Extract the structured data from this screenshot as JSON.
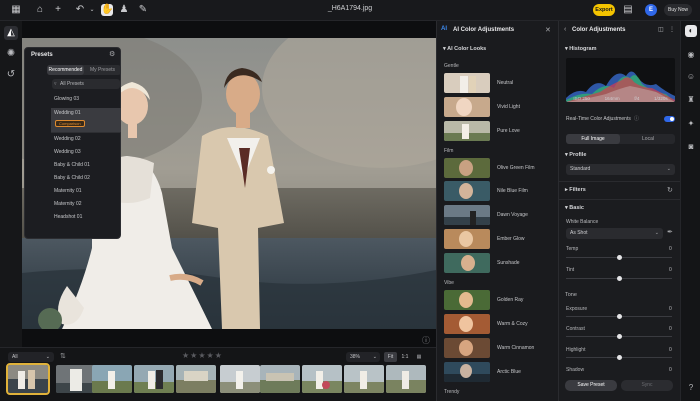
{
  "topbar": {
    "title": "_H6A1794.jpg",
    "export_label": "Export",
    "avatar_initial": "E",
    "buy_now_label": "Buy Now",
    "icons": [
      "grid-icon",
      "home-icon",
      "plus-icon",
      "undo-icon",
      "hand-icon",
      "stamp-icon",
      "brush-icon",
      "folder-icon",
      "gear-icon"
    ]
  },
  "presets": {
    "title": "Presets",
    "tabs": [
      "Recommended",
      "My Presets"
    ],
    "filter_label": "All Presets",
    "items": [
      "Glowing 03",
      "Wedding 01",
      "Wedding 02",
      "Wedding 03",
      "Baby & Child 01",
      "Baby & Child 02",
      "Maternity 01",
      "Maternity 02",
      "Headshot 01"
    ],
    "selected_item": "Wedding 01",
    "selected_tag": "Comparison"
  },
  "filmstrip": {
    "filter_value": "All",
    "zoom_value": "38%",
    "fit_label": "Fit",
    "one_to_one_label": "1:1",
    "stars": "★★★★★"
  },
  "ai_looks": {
    "title": "AI Color Adjustments",
    "section": "AI Color Looks",
    "groups": [
      {
        "name": "Gentle",
        "looks": [
          "Neutral",
          "Vivid Light",
          "Pure Love"
        ]
      },
      {
        "name": "Film",
        "looks": [
          "Olive Green Film",
          "Nile Blue Film",
          "Dawn Voyage",
          "Ember Glow",
          "Sunshade"
        ]
      },
      {
        "name": "Vibe",
        "looks": [
          "Golden Ray",
          "Warm & Cozy",
          "Warm Cinnamon",
          "Arctic Blue"
        ]
      },
      {
        "name": "Trendy",
        "looks": []
      }
    ]
  },
  "color_panel": {
    "title": "Color Adjustments",
    "histogram_label": "Histogram",
    "hist_info": [
      "ISO 250",
      "164mm",
      "f/4",
      "1/320s"
    ],
    "realtime_label": "Real-Time Color Adjustments",
    "realtime_on": true,
    "seg": [
      "Full Image",
      "Local"
    ],
    "profile_label": "Profile",
    "profile_value": "Standard",
    "filters_label": "Filters",
    "basic_label": "Basic",
    "white_balance_label": "White Balance",
    "white_balance_value": "As Shot",
    "temp_label": "Temp",
    "temp_value": "0",
    "tint_label": "Tint",
    "tint_value": "0",
    "tone_label": "Tone",
    "exposure_label": "Exposure",
    "exposure_value": "0",
    "contrast_label": "Contrast",
    "contrast_value": "0",
    "highlight_label": "Highlight",
    "highlight_value": "0",
    "shadow_label": "Shadow",
    "shadow_value": "0",
    "save_preset_label": "Save Preset",
    "sync_label": "Sync"
  },
  "colors": {
    "accent": "#f4c400",
    "toggle": "#2f67e8",
    "tag": "#e08b2f"
  }
}
